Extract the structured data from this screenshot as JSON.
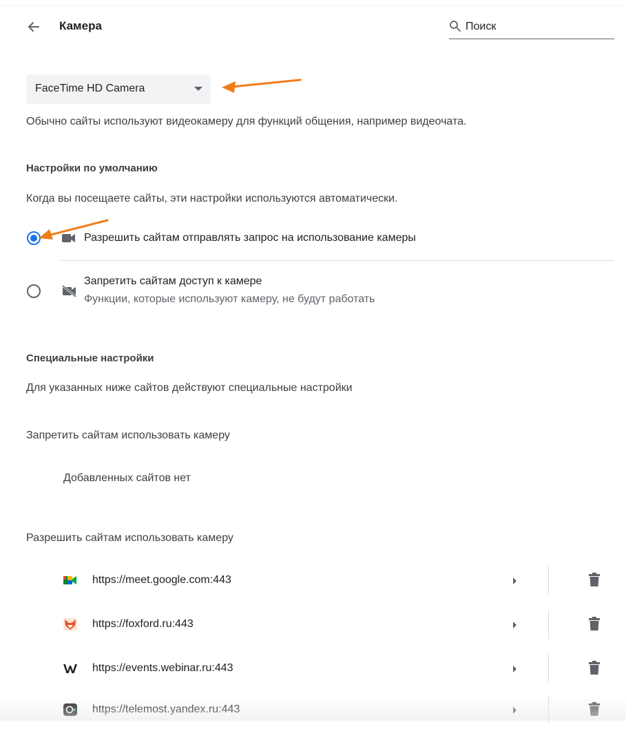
{
  "header": {
    "title": "Камера",
    "search_placeholder": "Поиск"
  },
  "device_select": {
    "selected": "FaceTime HD Camera"
  },
  "description": "Обычно сайты используют видеокамеру для функций общения, например видеочата.",
  "defaults": {
    "heading": "Настройки по умолчанию",
    "subtitle": "Когда вы посещаете сайты, эти настройки используются автоматически.",
    "options": [
      {
        "label": "Разрешить сайтам отправлять запрос на использование камеры",
        "sublabel": "",
        "selected": true,
        "icon": "camera-icon"
      },
      {
        "label": "Запретить сайтам доступ к камере",
        "sublabel": "Функции, которые используют камеру, не будут работать",
        "selected": false,
        "icon": "camera-off-icon"
      }
    ]
  },
  "custom": {
    "heading": "Специальные настройки",
    "subtitle": "Для указанных ниже сайтов действуют специальные настройки",
    "block_heading": "Запретить сайтам использовать камеру",
    "block_empty": "Добавленных сайтов нет",
    "allow_heading": "Разрешить сайтам использовать камеру",
    "allow_sites": [
      {
        "url": "https://meet.google.com:443",
        "icon": "google-meet-icon"
      },
      {
        "url": "https://foxford.ru:443",
        "icon": "foxford-icon"
      },
      {
        "url": "https://events.webinar.ru:443",
        "icon": "webinar-icon"
      },
      {
        "url": "https://telemost.yandex.ru:443",
        "icon": "telemost-icon"
      }
    ]
  },
  "colors": {
    "accent": "#1a73e8",
    "annotation": "#f07c1a",
    "select_bg": "#f1f3f4"
  }
}
